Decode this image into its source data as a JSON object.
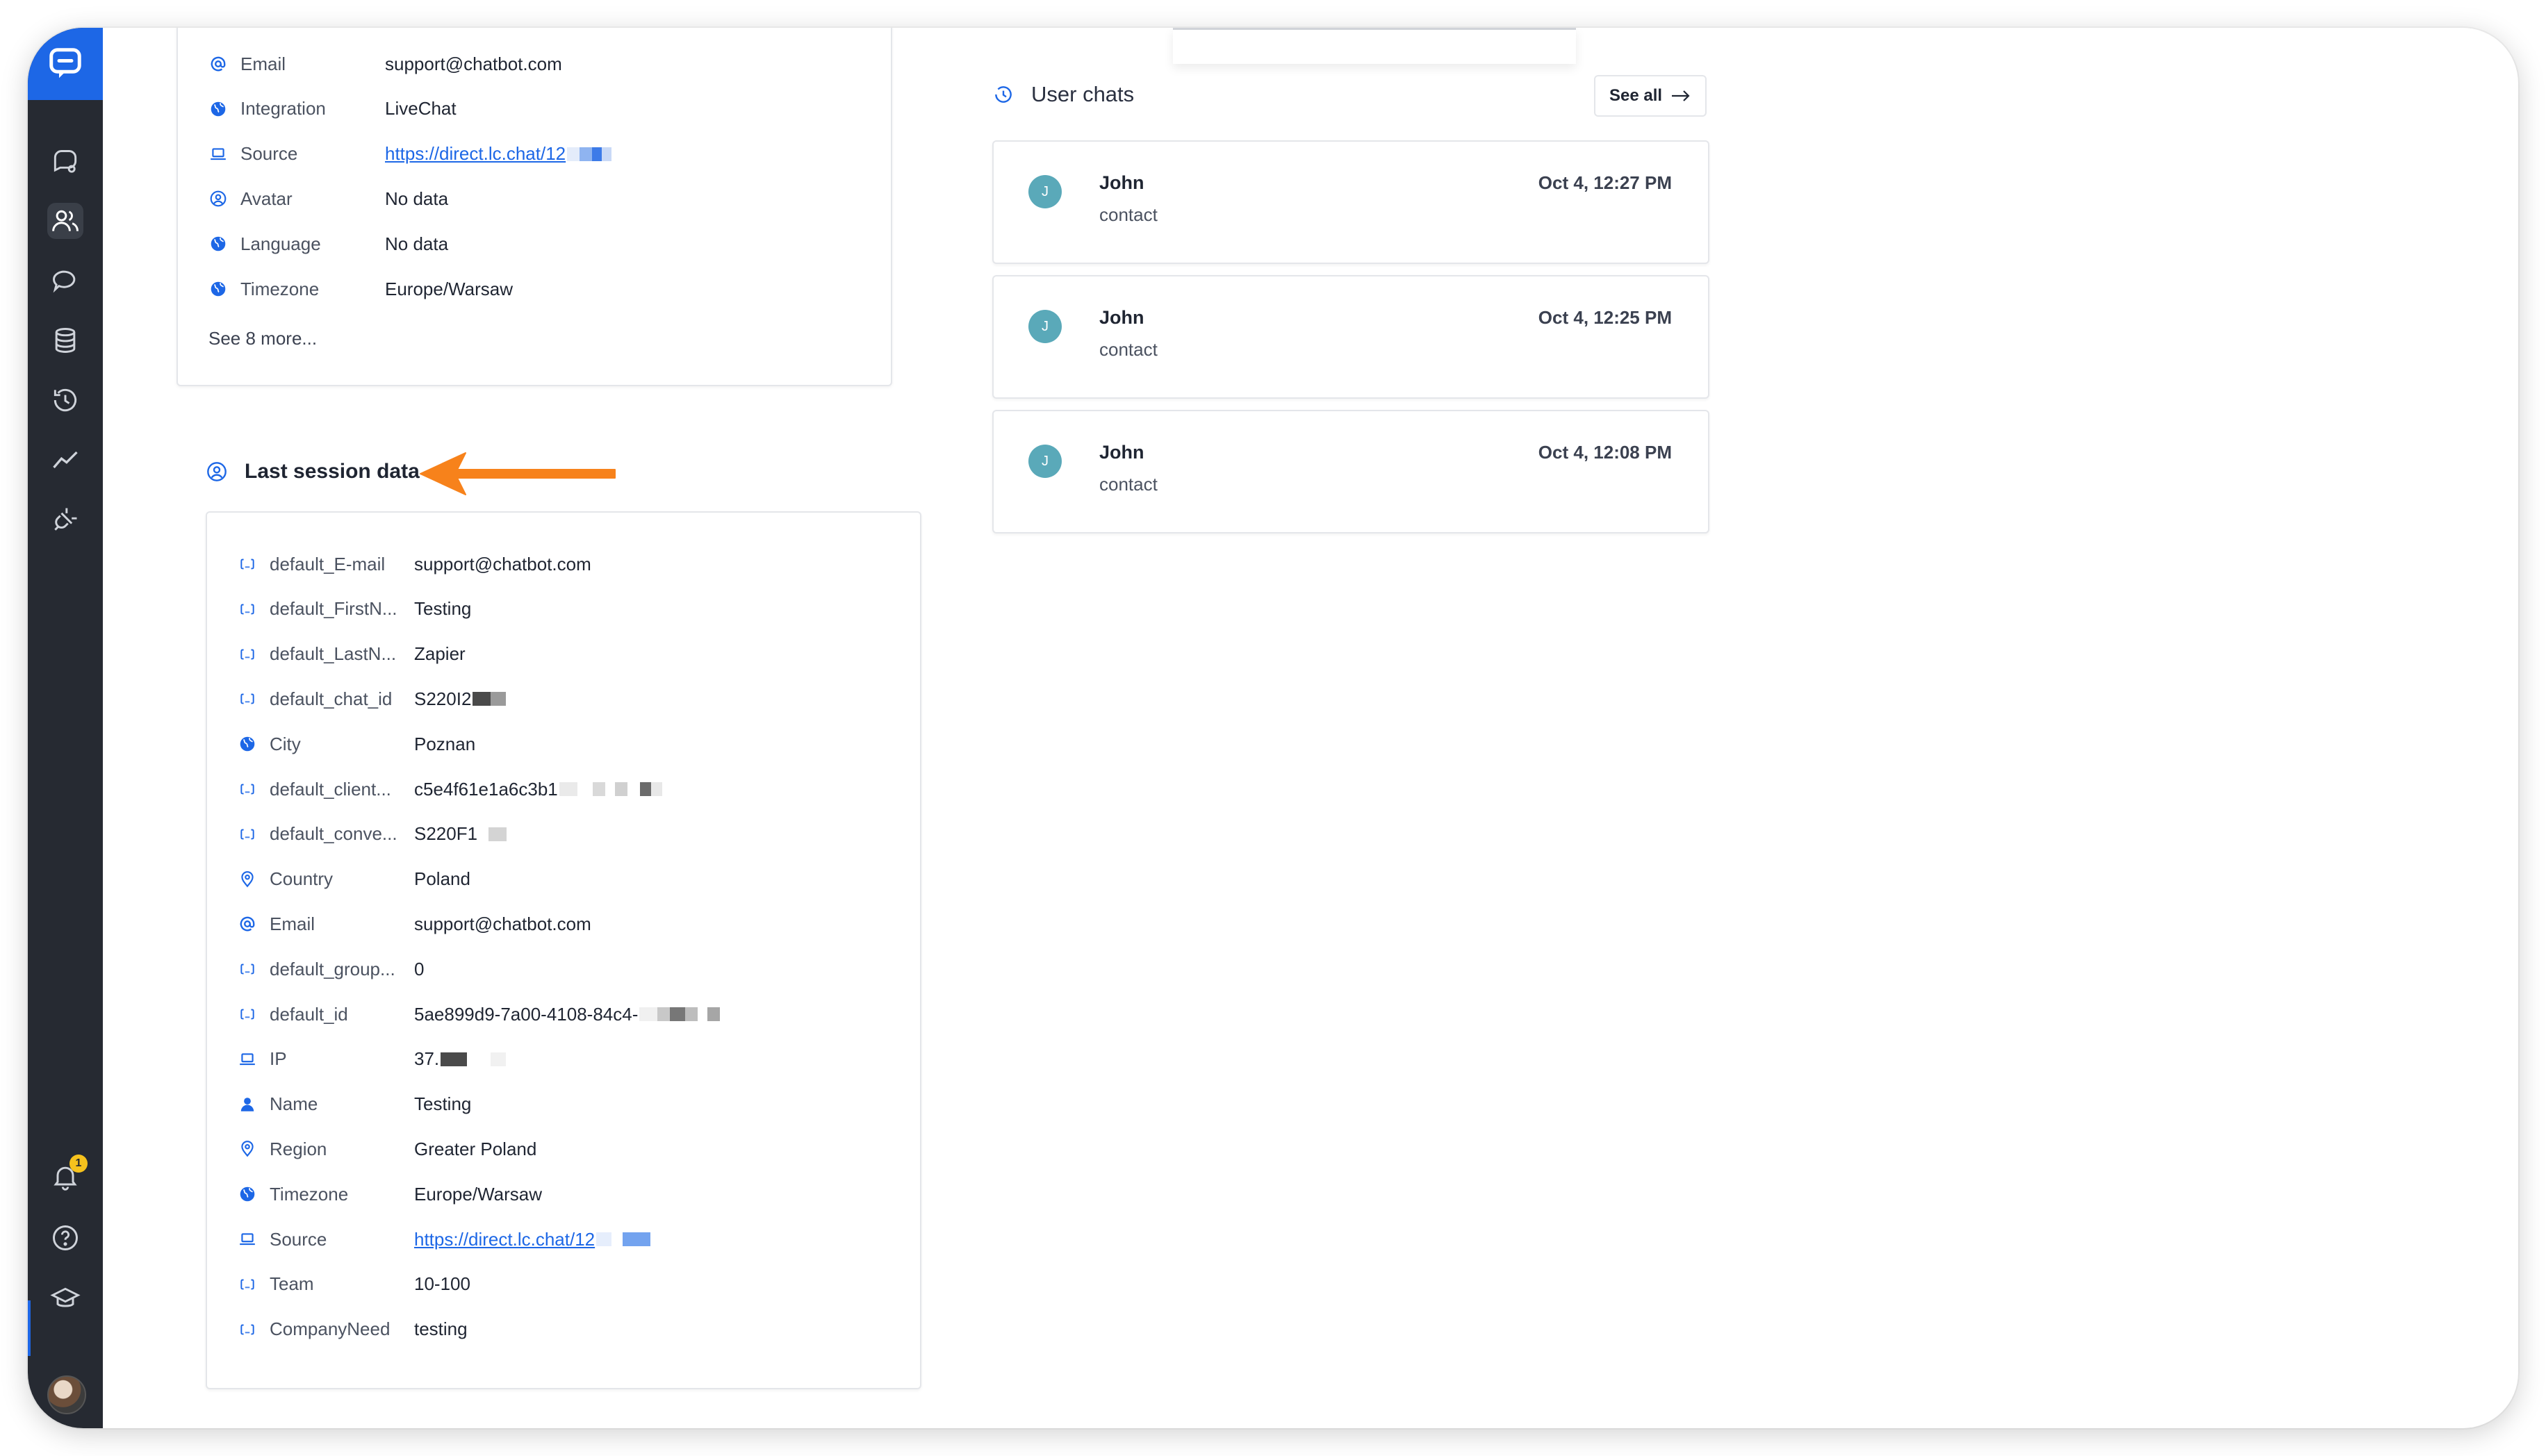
{
  "contact_details": {
    "rows": [
      {
        "icon": "at-icon",
        "label": "Email",
        "value": "support@chatbot.com",
        "link": false
      },
      {
        "icon": "globe-icon",
        "label": "Integration",
        "value": "LiveChat",
        "link": false
      },
      {
        "icon": "laptop-icon",
        "label": "Source",
        "value": "https://direct.lc.chat/12",
        "link": true
      },
      {
        "icon": "user-circle-icon",
        "label": "Avatar",
        "value": "No data",
        "link": false
      },
      {
        "icon": "globe-icon",
        "label": "Language",
        "value": "No data",
        "link": false
      },
      {
        "icon": "globe-icon",
        "label": "Timezone",
        "value": "Europe/Warsaw",
        "link": false
      }
    ],
    "see_more": "See 8 more..."
  },
  "last_session": {
    "title": "Last session data",
    "rows": [
      {
        "icon": "variable-icon",
        "label": "default_E-mail",
        "value": "support@chatbot.com",
        "link": false
      },
      {
        "icon": "variable-icon",
        "label": "default_FirstN...",
        "value": "Testing",
        "link": false
      },
      {
        "icon": "variable-icon",
        "label": "default_LastN...",
        "value": "Zapier",
        "link": false
      },
      {
        "icon": "variable-icon",
        "label": "default_chat_id",
        "value": "S220I2",
        "link": false
      },
      {
        "icon": "globe-icon",
        "label": "City",
        "value": "Poznan",
        "link": false
      },
      {
        "icon": "variable-icon",
        "label": "default_client...",
        "value": "c5e4f61e1a6c3b1",
        "link": false
      },
      {
        "icon": "variable-icon",
        "label": "default_conve...",
        "value": "S220F1",
        "link": false
      },
      {
        "icon": "pin-icon",
        "label": "Country",
        "value": "Poland",
        "link": false
      },
      {
        "icon": "at-icon",
        "label": "Email",
        "value": "support@chatbot.com",
        "link": false
      },
      {
        "icon": "variable-icon",
        "label": "default_group...",
        "value": "0",
        "link": false
      },
      {
        "icon": "variable-icon",
        "label": "default_id",
        "value": "5ae899d9-7a00-4108-84c4-",
        "link": false
      },
      {
        "icon": "laptop-icon",
        "label": "IP",
        "value": "37.",
        "link": false
      },
      {
        "icon": "person-icon",
        "label": "Name",
        "value": "Testing",
        "link": false
      },
      {
        "icon": "pin-icon",
        "label": "Region",
        "value": "Greater Poland",
        "link": false
      },
      {
        "icon": "globe-icon",
        "label": "Timezone",
        "value": "Europe/Warsaw",
        "link": false
      },
      {
        "icon": "laptop-icon",
        "label": "Source",
        "value": "https://direct.lc.chat/12",
        "link": true
      },
      {
        "icon": "variable-icon",
        "label": "Team",
        "value": "10-100",
        "link": false
      },
      {
        "icon": "variable-icon",
        "label": "CompanyNeed",
        "value": "testing",
        "link": false
      }
    ]
  },
  "user_chats": {
    "title": "User chats",
    "see_all": "See all",
    "chats": [
      {
        "initial": "J",
        "name": "John",
        "type": "contact",
        "time": "Oct 4, 12:27 PM"
      },
      {
        "initial": "J",
        "name": "John",
        "type": "contact",
        "time": "Oct 4, 12:25 PM"
      },
      {
        "initial": "J",
        "name": "John",
        "type": "contact",
        "time": "Oct 4, 12:08 PM"
      }
    ]
  },
  "sidebar": {
    "items": [
      "chat-bubble-icon",
      "users-icon",
      "chats-icon",
      "database-icon",
      "history-icon",
      "analytics-icon",
      "plug-icon"
    ],
    "bottom": [
      "bell-icon",
      "help-icon",
      "academy-icon"
    ],
    "notification_count": "1"
  },
  "colors": {
    "accent": "#1d67e6",
    "sidebar": "#262a32",
    "arrow": "#f7821b",
    "chat_avatar": "#5aa9b9"
  }
}
